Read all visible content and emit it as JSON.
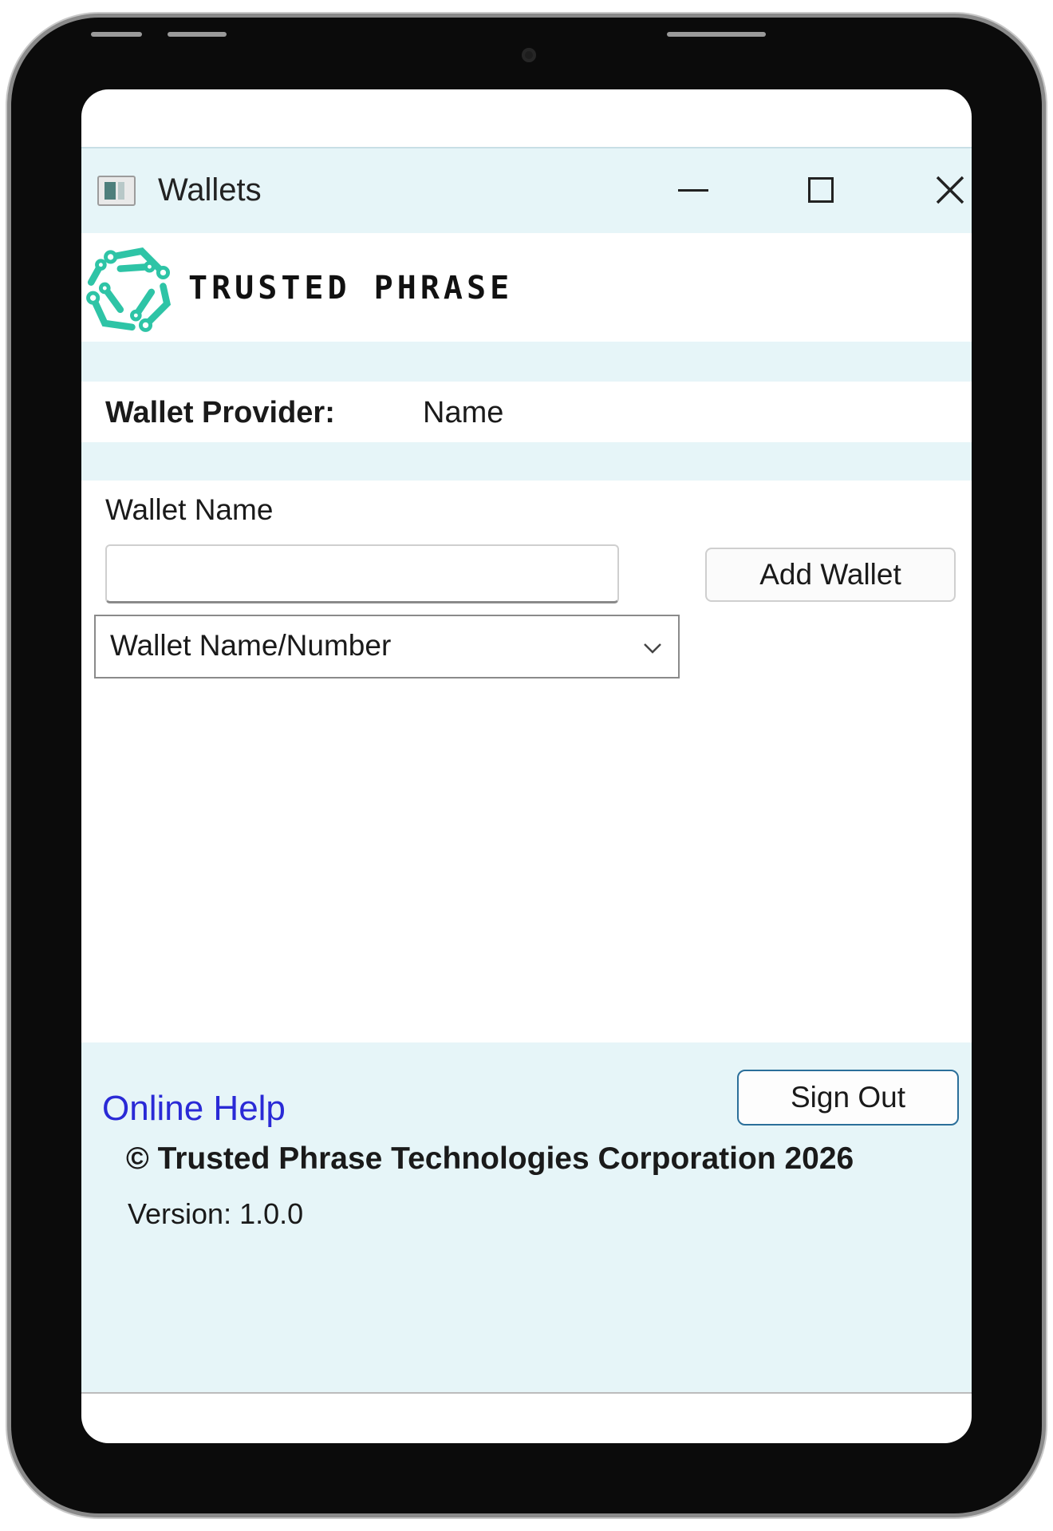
{
  "window": {
    "title": "Wallets",
    "controls": {
      "minimize": "minimize-icon",
      "maximize": "maximize-icon",
      "close": "close-icon"
    }
  },
  "brand": {
    "name": "TRUSTED PHRASE",
    "accent": "#2ec4a6"
  },
  "provider": {
    "label": "Wallet Provider:",
    "value": "Name"
  },
  "wallet_form": {
    "name_label": "Wallet Name",
    "name_value": "",
    "add_button": "Add Wallet",
    "select_value": "Wallet Name/Number"
  },
  "footer": {
    "help_link": "Online Help",
    "sign_out": "Sign Out",
    "copyright": "© Trusted Phrase Technologies Corporation  2026",
    "version": "Version: 1.0.0"
  },
  "colors": {
    "band": "#e6f5f8",
    "link": "#2a2ad6",
    "device": "#0b0b0b"
  }
}
